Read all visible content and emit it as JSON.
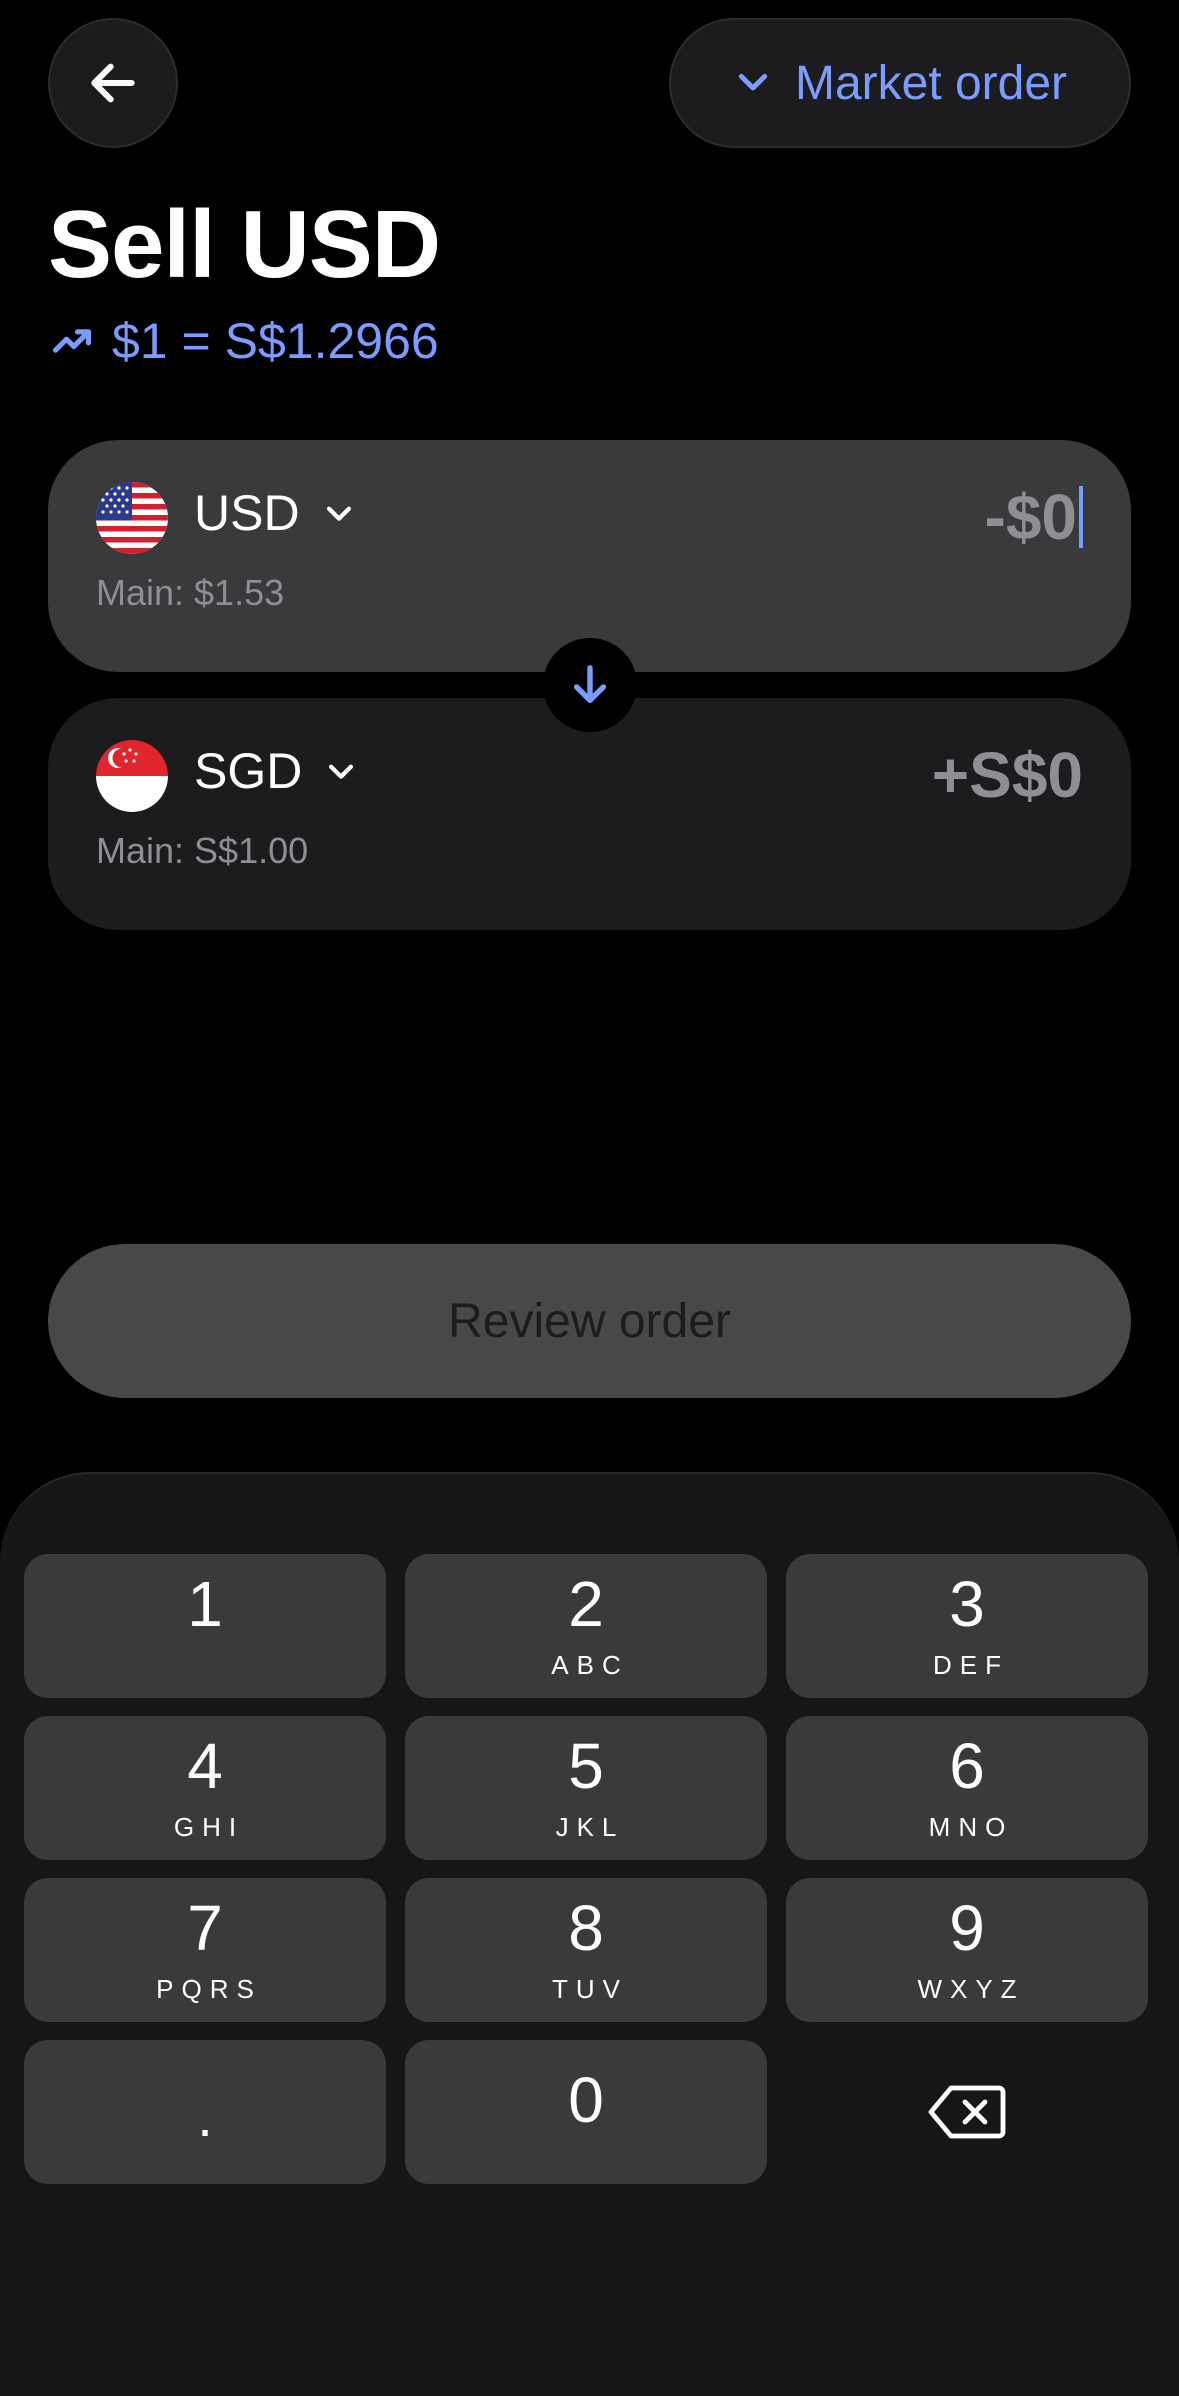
{
  "header": {
    "order_type_label": "Market order"
  },
  "title": "Sell USD",
  "rate": "$1 = S$1.2966",
  "from": {
    "currency": "USD",
    "balance": "Main: $1.53",
    "amount": "-$0"
  },
  "to": {
    "currency": "SGD",
    "balance": "Main: S$1.00",
    "amount": "+S$0"
  },
  "review_label": "Review order",
  "keypad": {
    "k1": {
      "digit": "1",
      "letters": ""
    },
    "k2": {
      "digit": "2",
      "letters": "ABC"
    },
    "k3": {
      "digit": "3",
      "letters": "DEF"
    },
    "k4": {
      "digit": "4",
      "letters": "GHI"
    },
    "k5": {
      "digit": "5",
      "letters": "JKL"
    },
    "k6": {
      "digit": "6",
      "letters": "MNO"
    },
    "k7": {
      "digit": "7",
      "letters": "PQRS"
    },
    "k8": {
      "digit": "8",
      "letters": "TUV"
    },
    "k9": {
      "digit": "9",
      "letters": "WXYZ"
    },
    "kdot": {
      "digit": "."
    },
    "k0": {
      "digit": "0"
    }
  },
  "colors": {
    "accent": "#7b9cff",
    "background": "#000000",
    "card_active": "#3a3a3c",
    "card_inactive": "#1c1c1e"
  },
  "icons": {
    "back": "arrow-left-icon",
    "order_type": "chevron-down-icon",
    "rate": "trending-up-icon",
    "swap": "arrow-down-icon",
    "delete": "backspace-icon"
  }
}
